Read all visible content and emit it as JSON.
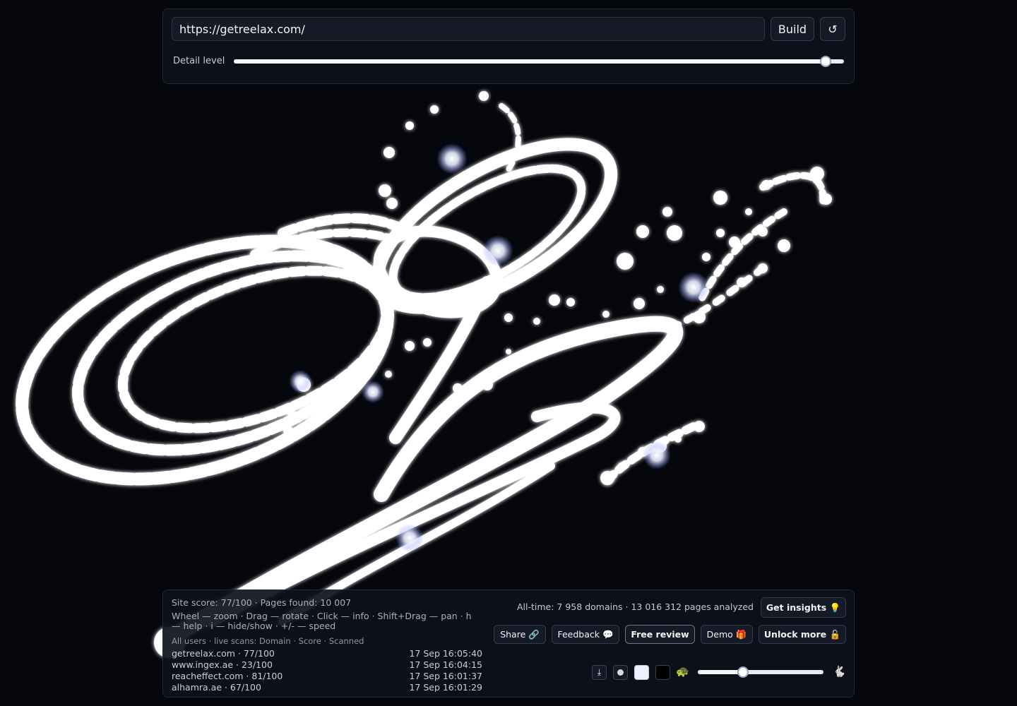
{
  "top": {
    "url_value": "https://getreelax.com/",
    "build_label": "Build",
    "refresh_icon": "↺",
    "detail_label": "Detail level",
    "detail_level": 0.97
  },
  "stats": {
    "site_score": "Site score: 77/100 · Pages found: 10 007",
    "help": "Wheel — zoom · Drag — rotate · Click — info · Shift+Drag — pan · h — help · i — hide/show · +/- — speed",
    "scans_header": "All users · live scans: Domain · Score · Scanned",
    "alltime": "All-time: 7 958 domains · 13 016 312 pages analyzed"
  },
  "scans": [
    {
      "domain": "getreelax.com · 77/100",
      "time": "17 Sep 16:05:40"
    },
    {
      "domain": "www.ingex.ae · 23/100",
      "time": "17 Sep 16:04:15"
    },
    {
      "domain": "reacheffect.com · 81/100",
      "time": "17 Sep 16:01:37"
    },
    {
      "domain": "alhamra.ae · 67/100",
      "time": "17 Sep 16:01:29"
    }
  ],
  "actions": {
    "insights": "Get insights 💡",
    "share": "Share 🔗",
    "feedback": "Feedback 💬",
    "review": "Free review",
    "demo": "Demo 🎁",
    "unlock": "Unlock more 🔓"
  },
  "controls": {
    "download_icon": "⤓",
    "turtle_icon": "🐢",
    "rabbit_icon": "🐇",
    "speed_level": 0.36
  }
}
